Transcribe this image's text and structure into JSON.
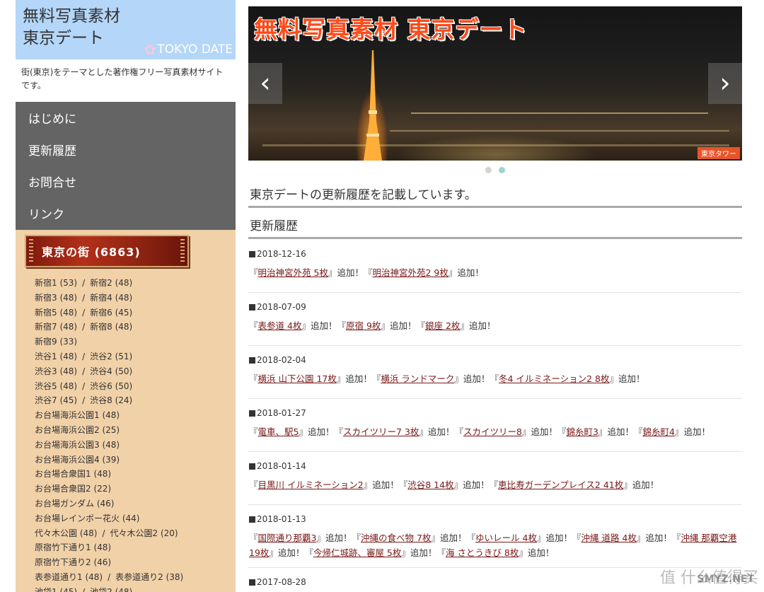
{
  "logo": {
    "title": "無料写真素材\n東京デート",
    "sub": "TOKYO DATE"
  },
  "site_desc": "街(東京)をテーマとした著作権フリー写真素材サイトです。",
  "nav": [
    "はじめに",
    "更新履歴",
    "お問合せ",
    "リンク"
  ],
  "category_banner": "東京の街 (6863)",
  "categories": [
    [
      "新宿1 (53)",
      "新宿2 (48)"
    ],
    [
      "新宿3 (48)",
      "新宿4 (48)"
    ],
    [
      "新宿5 (48)",
      "新宿6 (45)"
    ],
    [
      "新宿7 (48)",
      "新宿8 (48)"
    ],
    [
      "新宿9 (33)"
    ],
    [
      "渋谷1 (48)",
      "渋谷2 (51)"
    ],
    [
      "渋谷3 (48)",
      "渋谷4 (50)"
    ],
    [
      "渋谷5 (48)",
      "渋谷6 (50)"
    ],
    [
      "渋谷7 (45)",
      "渋谷8 (24)"
    ],
    [
      "お台場海浜公園1 (48)"
    ],
    [
      "お台場海浜公園2 (25)"
    ],
    [
      "お台場海浜公園3 (48)"
    ],
    [
      "お台場海浜公園4 (39)"
    ],
    [
      "お台場合衆国1 (48)"
    ],
    [
      "お台場合衆国2 (22)"
    ],
    [
      "お台場ガンダム (46)"
    ],
    [
      "お台場レインボー花火 (44)"
    ],
    [
      "代々木公園 (48)",
      "代々木公園2 (20)"
    ],
    [
      "原宿竹下通り1 (48)"
    ],
    [
      "原宿竹下通り2 (46)"
    ],
    [
      "表参道通り1 (48)",
      "表参道通り2 (38)"
    ],
    [
      "池袋1 (45)",
      "池袋2 (48)"
    ]
  ],
  "slider": {
    "title": "無料写真素材 東京デート",
    "caption": "東京タワー",
    "prev_icon": "‹",
    "next_icon": "›"
  },
  "intro": "東京デートの更新履歴を記載しています。",
  "section_title": "更新履歴",
  "updates": [
    {
      "date": "2018-12-16",
      "items": [
        [
          "明治神宮外苑 5枚",
          "追加！"
        ],
        [
          "明治神宮外苑2 9枚",
          "追加！"
        ]
      ]
    },
    {
      "date": "2018-07-09",
      "items": [
        [
          "表参道 4枚",
          "追加！"
        ],
        [
          "原宿 9枚",
          "追加！"
        ],
        [
          "銀座 2枚",
          "追加！"
        ]
      ]
    },
    {
      "date": "2018-02-04",
      "items": [
        [
          "横浜 山下公園 17枚",
          "追加！"
        ],
        [
          "横浜 ランドマーク",
          "追加！"
        ],
        [
          "冬4 イルミネーション2 8枚",
          "追加！"
        ]
      ]
    },
    {
      "date": "2018-01-27",
      "items": [
        [
          "電車、駅5",
          "追加！"
        ],
        [
          "スカイツリー7 3枚",
          "追加！"
        ],
        [
          "スカイツリー8",
          "追加！"
        ],
        [
          "錦糸町3",
          "追加！"
        ],
        [
          "錦糸町4",
          "追加！"
        ]
      ]
    },
    {
      "date": "2018-01-14",
      "items": [
        [
          "目黒川 イルミネーション2",
          "追加！"
        ],
        [
          "渋谷8 14枚",
          "追加！"
        ],
        [
          "恵比寿ガーデンプレイス2 41枚",
          "追加！"
        ]
      ]
    },
    {
      "date": "2018-01-13",
      "items": [
        [
          "国際通り那覇3",
          "追加！"
        ],
        [
          "沖縄の食べ物 7枚",
          "追加！"
        ],
        [
          "ゆいレール 4枚",
          "追加！"
        ],
        [
          "沖縄 道路 4枚",
          "追加！"
        ],
        [
          "沖縄 那覇空港 19枚",
          "追加！"
        ],
        [
          "今帰仁城跡、審屋 5枚",
          "追加！"
        ],
        [
          "海 さとうきび 8枚",
          "追加！"
        ]
      ]
    },
    {
      "date": "2017-08-28",
      "items": []
    }
  ],
  "watermark": {
    "text": "值 什么值得买",
    "url": "SMYZ.NET"
  },
  "colors": {
    "logo_bg": "#b4d6f8",
    "nav_bg": "#646464",
    "sidebar_bg": "#f1d1a8",
    "link": "#7a1818",
    "slide_title": "#ff4a1a"
  }
}
